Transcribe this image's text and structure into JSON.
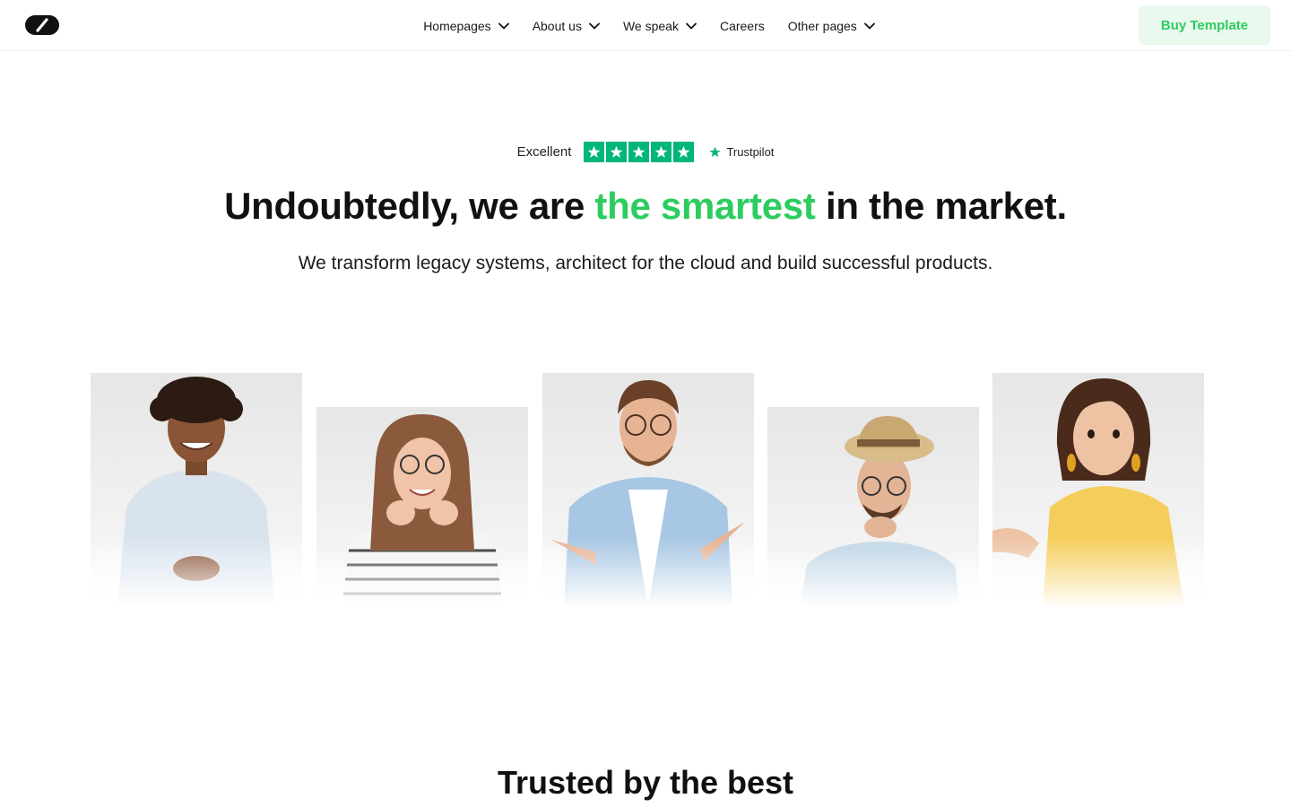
{
  "header": {
    "logo_icon": "brand-logo-icon",
    "nav": [
      {
        "label": "Homepages",
        "has_dropdown": true
      },
      {
        "label": "About us",
        "has_dropdown": true
      },
      {
        "label": "We speak",
        "has_dropdown": true
      },
      {
        "label": "Careers",
        "has_dropdown": false
      },
      {
        "label": "Other pages",
        "has_dropdown": true
      }
    ],
    "cta_label": "Buy Template"
  },
  "trust": {
    "rating_word": "Excellent",
    "stars": 5,
    "provider": "Trustpilot",
    "star_color": "#00b67a"
  },
  "hero": {
    "title_before": "Undoubtedly, we are ",
    "title_accent": "the smartest",
    "title_after": " in the market.",
    "subtitle": "We transform legacy systems, architect for the cloud and build successful products.",
    "accent_color": "#2dcc5f"
  },
  "portraits": [
    {
      "description_icon": "person-smiling-shirt"
    },
    {
      "description_icon": "person-glasses-striped"
    },
    {
      "description_icon": "person-pointing-glasses"
    },
    {
      "description_icon": "person-hat-thinking"
    },
    {
      "description_icon": "person-yellow-shrug"
    }
  ],
  "trusted": {
    "title": "Trusted by the best"
  }
}
